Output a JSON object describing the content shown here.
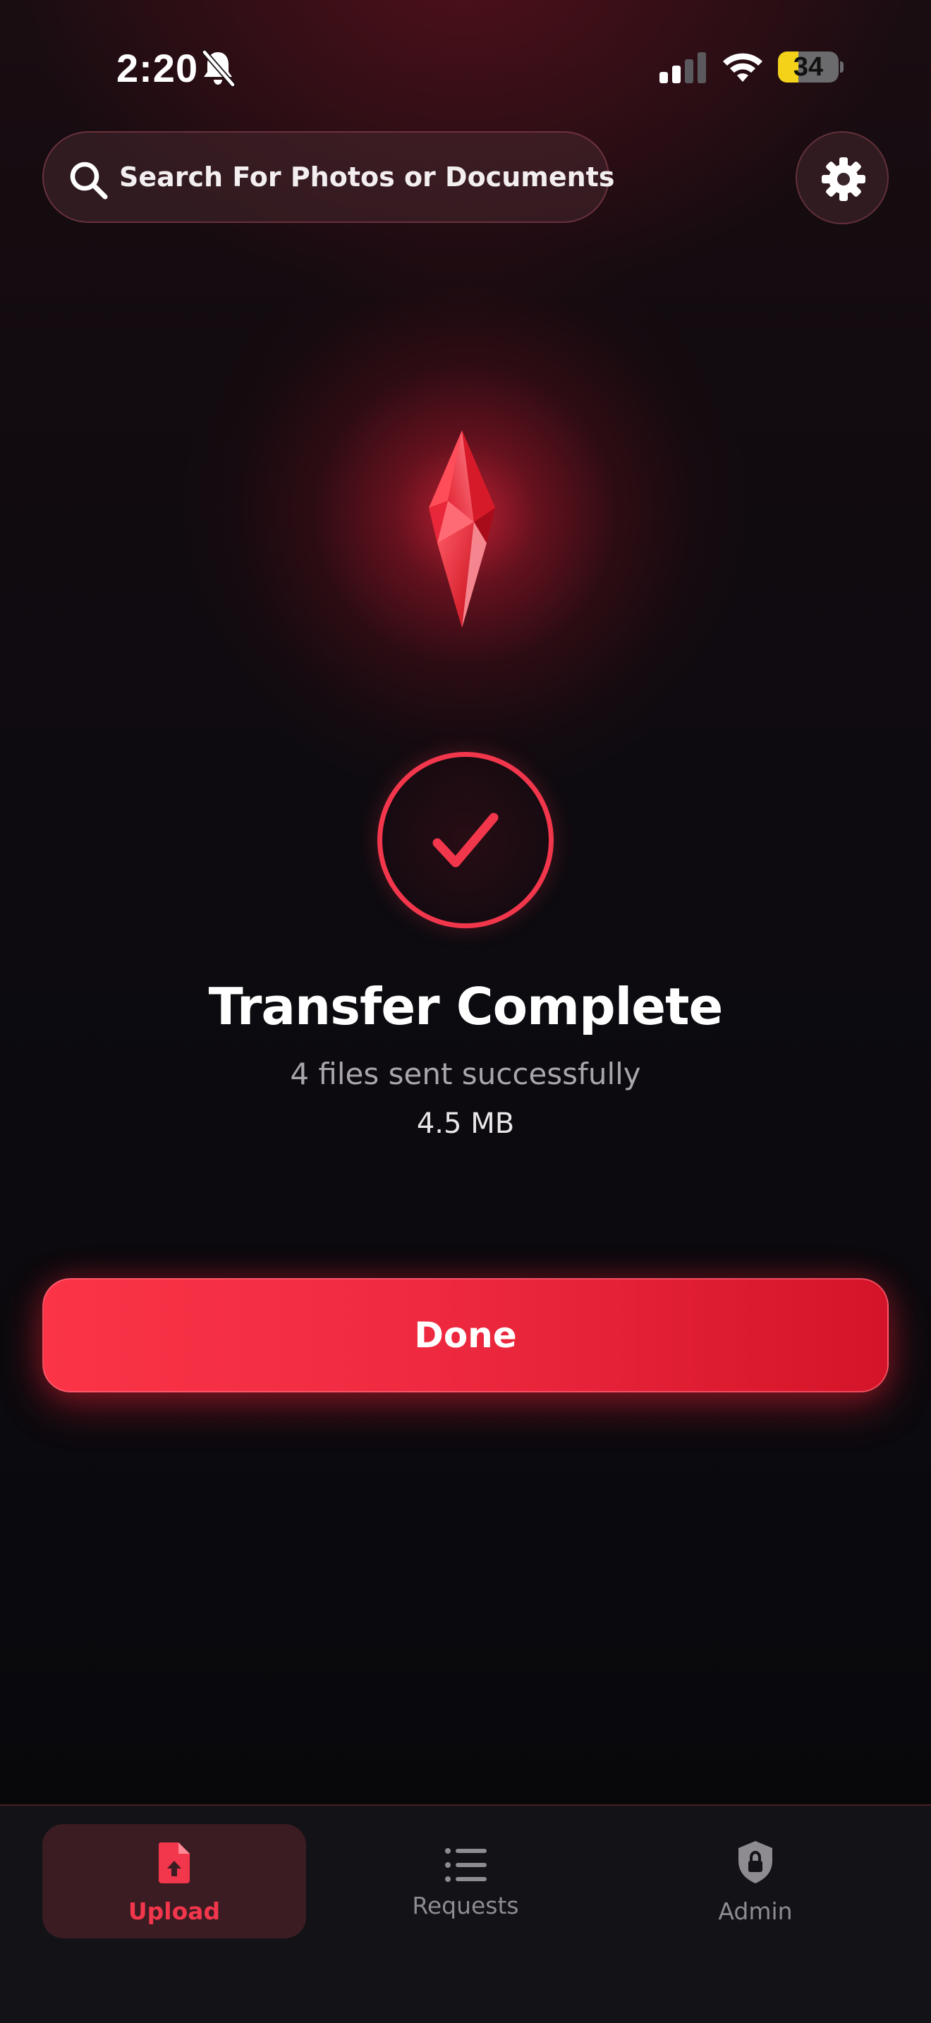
{
  "status_bar": {
    "time": "2:20",
    "battery_level": "34",
    "battery_fraction": 0.34,
    "icons": [
      "bell-slash-icon",
      "cellular-signal-icon",
      "wifi-icon",
      "battery-icon"
    ]
  },
  "search": {
    "placeholder": "Search For Photos or Documents",
    "icon": "search-icon"
  },
  "settings": {
    "icon": "gear-icon"
  },
  "hero": {
    "icon": "red-crystal-icon",
    "status_icon": "checkmark-icon"
  },
  "result": {
    "title": "Transfer Complete",
    "subtitle": "4 files sent successfully",
    "size": "4.5 MB"
  },
  "actions": {
    "done_label": "Done"
  },
  "tab_bar": {
    "tabs": [
      {
        "label": "Upload",
        "icon": "document-upload-icon",
        "active": true
      },
      {
        "label": "Requests",
        "icon": "list-icon",
        "active": false
      },
      {
        "label": "Admin",
        "icon": "shield-lock-icon",
        "active": false
      }
    ]
  },
  "colors": {
    "accent": "#f2364c",
    "button_start": "#fb3447",
    "button_end": "#d41428",
    "battery": "#f4d21a",
    "background": "#0b0a0e"
  }
}
